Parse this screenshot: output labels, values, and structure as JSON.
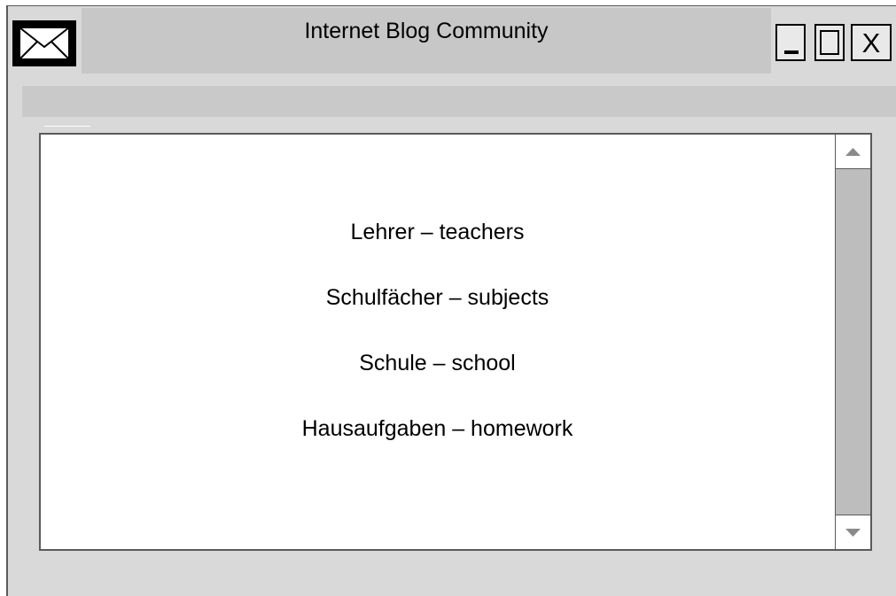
{
  "window": {
    "title": "Internet Blog Community",
    "controls": {
      "close_label": "X"
    }
  },
  "content": {
    "items": [
      "Lehrer – teachers",
      "Schulfächer – subjects",
      "Schule – school",
      "Hausaufgaben – homework"
    ]
  },
  "icons": {
    "app": "mail-icon",
    "minimize": "minimize-icon",
    "maximize": "maximize-icon",
    "close": "close-icon",
    "scroll_up": "arrow-up-icon",
    "scroll_down": "arrow-down-icon"
  },
  "colors": {
    "window_bg": "#d9d9d9",
    "title_bar": "#c7c7c7",
    "scroll_track": "#bdbdbd"
  }
}
